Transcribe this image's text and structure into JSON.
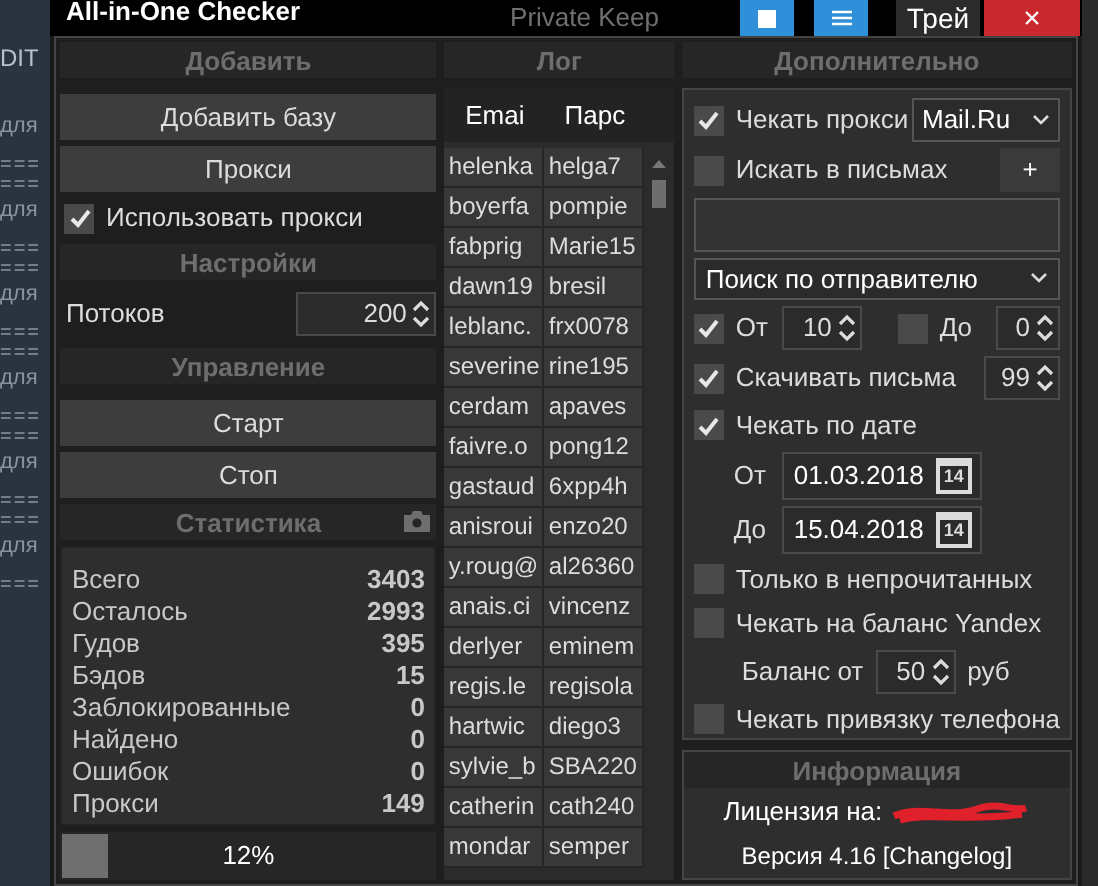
{
  "background": {
    "top_text": "Private Keep",
    "side_label": "DIT",
    "side_lines": [
      {
        "kind": "text",
        "text": "для"
      },
      {
        "kind": "rule",
        "text": "==="
      },
      {
        "kind": "rule",
        "text": "==="
      },
      {
        "kind": "text",
        "text": "для"
      },
      {
        "kind": "rule",
        "text": "==="
      },
      {
        "kind": "rule",
        "text": "==="
      },
      {
        "kind": "text",
        "text": "для"
      },
      {
        "kind": "rule",
        "text": "==="
      },
      {
        "kind": "rule",
        "text": "==="
      },
      {
        "kind": "text",
        "text": "для"
      },
      {
        "kind": "rule",
        "text": "==="
      },
      {
        "kind": "rule",
        "text": "==="
      },
      {
        "kind": "text",
        "text": "для"
      },
      {
        "kind": "rule",
        "text": "==="
      },
      {
        "kind": "rule",
        "text": "==="
      },
      {
        "kind": "text",
        "text": "для"
      },
      {
        "kind": "rule",
        "text": "==="
      }
    ]
  },
  "window": {
    "title": "All-in-One Checker",
    "controls": [
      {
        "kind": "square"
      },
      {
        "kind": "menu"
      },
      {
        "kind": "text",
        "label": "Трей"
      },
      {
        "kind": "close",
        "label": "×"
      }
    ]
  },
  "add": {
    "header": "Добавить",
    "buttons": [
      "Добавить базу",
      "Прокси"
    ],
    "use_proxy": {
      "label": "Использовать прокси",
      "checked": true
    }
  },
  "settings": {
    "header": "Настройки",
    "threads_label": "Потоков",
    "threads": "200"
  },
  "control": {
    "header": "Управление",
    "buttons": [
      "Старт",
      "Стоп"
    ]
  },
  "stats": {
    "header": "Статистика",
    "rows": [
      {
        "label": "Всего",
        "value": "3403"
      },
      {
        "label": "Осталось",
        "value": "2993"
      },
      {
        "label": "Гудов",
        "value": "395"
      },
      {
        "label": "Бэдов",
        "value": "15"
      },
      {
        "label": "Заблокированные",
        "value": "0"
      },
      {
        "label": "Найдено",
        "value": "0"
      },
      {
        "label": "Ошибок",
        "value": "0"
      },
      {
        "label": "Прокси",
        "value": "149"
      }
    ],
    "progress": {
      "level": 0.12,
      "text": "12%"
    }
  },
  "log": {
    "header": "Лог",
    "columns": [
      "Emai",
      "Парс"
    ],
    "rows": [
      [
        "helenka",
        "helga7"
      ],
      [
        "boyerfa",
        "pompie"
      ],
      [
        "fabprig",
        "Marie15"
      ],
      [
        "dawn19",
        "bresil"
      ],
      [
        "leblanc.",
        "frx0078"
      ],
      [
        "severine",
        "rine195"
      ],
      [
        "cerdam",
        "apaves"
      ],
      [
        "faivre.o",
        "pong12"
      ],
      [
        "gastaud",
        "6xpp4h"
      ],
      [
        "anisroui",
        "enzo20"
      ],
      [
        "y.roug@",
        "al26360"
      ],
      [
        "anais.ci",
        "vincenz"
      ],
      [
        "derlyer",
        "eminem"
      ],
      [
        "regis.le",
        "regisola"
      ],
      [
        "hartwic",
        "diego3"
      ],
      [
        "sylvie_b",
        "SBA220"
      ],
      [
        "catherin",
        "cath240"
      ],
      [
        "mondar",
        "semper"
      ]
    ]
  },
  "extra": {
    "header": "Дополнительно",
    "check_proxy": {
      "label": "Чекать прокси",
      "checked": true,
      "service": "Mail.Ru"
    },
    "search_letters": {
      "label": "Искать в письмах",
      "checked": false,
      "add_button": "+"
    },
    "search_mode": "Поиск по отправителю",
    "from": {
      "label": "От",
      "checked": true,
      "value": "10"
    },
    "to": {
      "label": "До",
      "checked": false,
      "value": "0"
    },
    "download": {
      "label": "Скачивать письма",
      "checked": true,
      "value": "99"
    },
    "by_date": {
      "label": "Чекать по дате",
      "checked": true
    },
    "dates": [
      {
        "label": "От",
        "value": "01.03.2018",
        "calendar_day": "14"
      },
      {
        "label": "До",
        "value": "15.04.2018",
        "calendar_day": "14"
      }
    ],
    "unread": {
      "label": "Только в непрочитанных",
      "checked": false
    },
    "yandex": {
      "label": "Чекать на баланс Yandex",
      "checked": false
    },
    "balance": {
      "label": "Баланс от",
      "value": "50",
      "unit": "руб"
    },
    "phone": {
      "label": "Чекать привязку телефона",
      "checked": false
    }
  },
  "info": {
    "header": "Информация",
    "license_label": "Лицензия на:",
    "version": "Версия 4.16 [Changelog]"
  }
}
